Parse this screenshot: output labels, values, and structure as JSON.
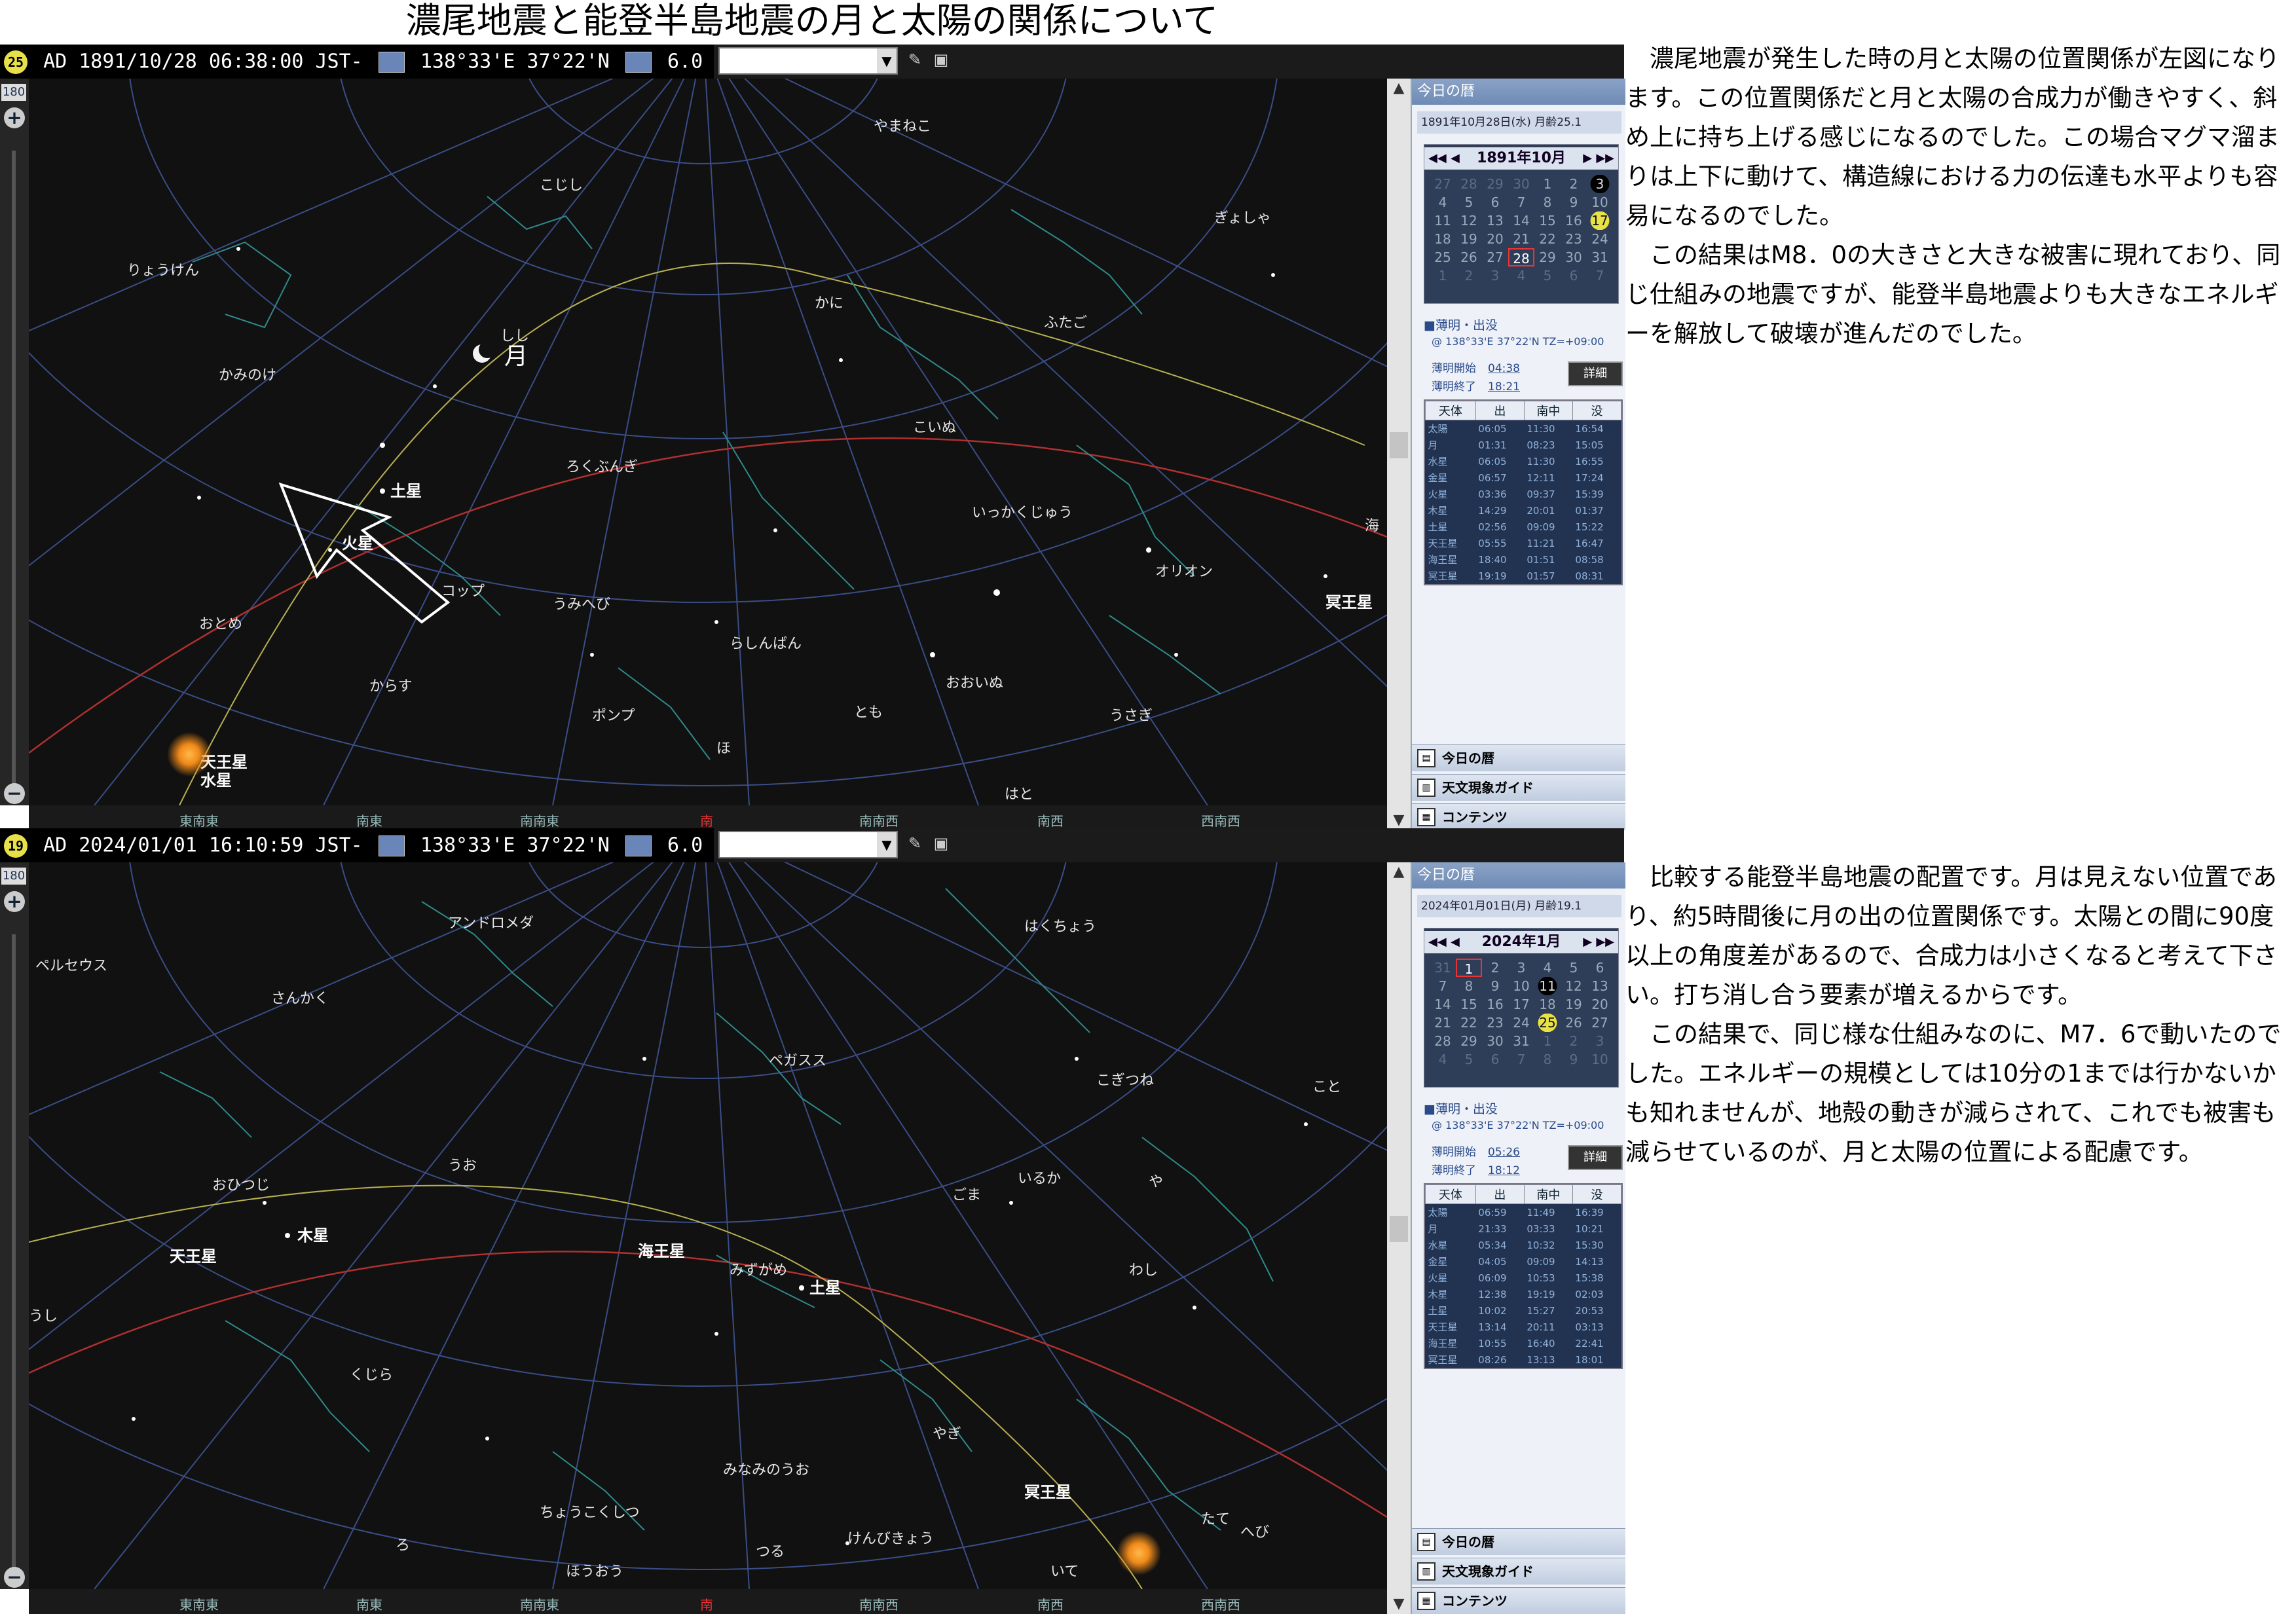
{
  "title": "濃尾地震と能登半島地震の月と太陽の関係について",
  "panels": [
    {
      "status": {
        "badge": "25",
        "datetime": "AD 1891/10/28 06:38:00 JST‐",
        "coords": "138°33'E 37°22'N",
        "mag": "6.0"
      },
      "scale_label": "180",
      "constellations": [
        "やまねこ",
        "こじし",
        "ぎょしゃ",
        "りょうけん",
        "かに",
        "ふたご",
        "しし",
        "かみのけ",
        "こいぬ",
        "ろくぶんぎ",
        "いっかくじゅう",
        "オリオン",
        "コップ",
        "うみへび",
        "おとめ",
        "らしんばん",
        "からす",
        "おおいぬ",
        "とも",
        "ポンプ",
        "うさぎ",
        "ほ",
        "はと",
        "海"
      ],
      "planets": [
        "土星",
        "火星",
        "冥王星",
        "天王星",
        "水星"
      ],
      "moon_label": "月",
      "directions": [
        "東南東",
        "南東",
        "南南東",
        "南",
        "南南西",
        "南西",
        "西南西"
      ],
      "side": {
        "header": "今日の暦",
        "date_line": "1891年10月28日(水)  月齢25.1",
        "month": "1891年10月",
        "nav_left": "◀◀ ◀",
        "nav_right": "▶ ▶▶",
        "weeks": [
          [
            "27",
            "28",
            "29",
            "30",
            "1",
            "2",
            "3"
          ],
          [
            "4",
            "5",
            "6",
            "7",
            "8",
            "9",
            "10"
          ],
          [
            "11",
            "12",
            "13",
            "14",
            "15",
            "16",
            "17"
          ],
          [
            "18",
            "19",
            "20",
            "21",
            "22",
            "23",
            "24"
          ],
          [
            "25",
            "26",
            "27",
            "28",
            "29",
            "30",
            "31"
          ],
          [
            "1",
            "2",
            "3",
            "4",
            "5",
            "6",
            "7"
          ]
        ],
        "twilight_head": "■薄明・出没",
        "twilight_loc": "@ 138°33'E 37°22'N TZ=+09:00",
        "twilight_start_label": "薄明開始",
        "twilight_start": "04:38",
        "twilight_end_label": "薄明終了",
        "twilight_end": "18:21",
        "detail": "詳細",
        "table_head": [
          "天体",
          "出",
          "南中",
          "没"
        ],
        "rows": [
          [
            "太陽",
            "06:05",
            "11:30",
            "16:54"
          ],
          [
            "月",
            "01:31",
            "08:23",
            "15:05"
          ],
          [
            "水星",
            "06:05",
            "11:30",
            "16:55"
          ],
          [
            "金星",
            "06:57",
            "12:11",
            "17:24"
          ],
          [
            "火星",
            "03:36",
            "09:37",
            "15:39"
          ],
          [
            "木星",
            "14:29",
            "20:01",
            "01:37"
          ],
          [
            "土星",
            "02:56",
            "09:09",
            "15:22"
          ],
          [
            "天王星",
            "05:55",
            "11:21",
            "16:47"
          ],
          [
            "海王星",
            "18:40",
            "01:51",
            "08:58"
          ],
          [
            "冥王星",
            "19:19",
            "01:57",
            "08:31"
          ]
        ],
        "buttons": [
          "今日の暦",
          "天文現象ガイド",
          "コンテンツ"
        ]
      },
      "description": [
        "濃尾地震が発生した時の月と太陽の位置関係が左図になります。この位置関係だと月と太陽の合成力が働きやすく、斜め上に持ち上げる感じになるのでした。この場合マグマ溜まりは上下に動けて、構造線における力の伝達も水平よりも容易になるのでした。",
        "この結果はM8．0の大きさと大きな被害に現れており、同じ仕組みの地震ですが、能登半島地震よりも大きなエネルギーを解放して破壊が進んだのでした。"
      ]
    },
    {
      "status": {
        "badge": "19",
        "datetime": "AD 2024/01/01 16:10:59 JST‐",
        "coords": "138°33'E 37°22'N",
        "mag": "6.0"
      },
      "scale_label": "180",
      "constellations": [
        "アンドロメダ",
        "はくちょう",
        "ペルセウス",
        "さんかく",
        "ペガスス",
        "こぎつね",
        "こと",
        "うお",
        "おひつじ",
        "ごま",
        "いるか",
        "や",
        "みずがめ",
        "わし",
        "くじら",
        "やぎ",
        "みなみのうお",
        "ちょうこくしつ",
        "つる",
        "けんびきょう",
        "たて",
        "へび",
        "ろ",
        "ほうおう",
        "いて",
        "うし"
      ],
      "planets": [
        "木星",
        "天王星",
        "海王星",
        "土星",
        "冥王星"
      ],
      "moon_label": "",
      "directions": [
        "東南東",
        "南東",
        "南南東",
        "南",
        "南南西",
        "南西",
        "西南西"
      ],
      "side": {
        "header": "今日の暦",
        "date_line": "2024年01月01日(月)  月齢19.1",
        "month": "2024年1月",
        "nav_left": "◀◀ ◀",
        "nav_right": "▶ ▶▶",
        "weeks": [
          [
            "31",
            "1",
            "2",
            "3",
            "4",
            "5",
            "6"
          ],
          [
            "7",
            "8",
            "9",
            "10",
            "11",
            "12",
            "13"
          ],
          [
            "14",
            "15",
            "16",
            "17",
            "18",
            "19",
            "20"
          ],
          [
            "21",
            "22",
            "23",
            "24",
            "25",
            "26",
            "27"
          ],
          [
            "28",
            "29",
            "30",
            "31",
            "1",
            "2",
            "3"
          ],
          [
            "4",
            "5",
            "6",
            "7",
            "8",
            "9",
            "10"
          ]
        ],
        "twilight_head": "■薄明・出没",
        "twilight_loc": "@ 138°33'E 37°22'N TZ=+09:00",
        "twilight_start_label": "薄明開始",
        "twilight_start": "05:26",
        "twilight_end_label": "薄明終了",
        "twilight_end": "18:12",
        "detail": "詳細",
        "table_head": [
          "天体",
          "出",
          "南中",
          "没"
        ],
        "rows": [
          [
            "太陽",
            "06:59",
            "11:49",
            "16:39"
          ],
          [
            "月",
            "21:33",
            "03:33",
            "10:21"
          ],
          [
            "水星",
            "05:34",
            "10:32",
            "15:30"
          ],
          [
            "金星",
            "04:05",
            "09:09",
            "14:13"
          ],
          [
            "火星",
            "06:09",
            "10:53",
            "15:38"
          ],
          [
            "木星",
            "12:38",
            "19:19",
            "02:03"
          ],
          [
            "土星",
            "10:02",
            "15:27",
            "20:53"
          ],
          [
            "天王星",
            "13:14",
            "20:11",
            "03:13"
          ],
          [
            "海王星",
            "10:55",
            "16:40",
            "22:41"
          ],
          [
            "冥王星",
            "08:26",
            "13:13",
            "18:01"
          ]
        ],
        "buttons": [
          "今日の暦",
          "天文現象ガイド",
          "コンテンツ"
        ]
      },
      "description": [
        "比較する能登半島地震の配置です。月は見えない位置であり、約5時間後に月の出の位置関係です。太陽との間に90度以上の角度差があるので、合成力は小さくなると考えて下さい。打ち消し合う要素が増えるからです。",
        "この結果で、同じ様な仕組みなのに、M7．6で動いたのでした。エネルギーの規模としては10分の1までは行かないかも知れませんが、地殻の動きが減らされて、これでも被害も減らせているのが、月と太陽の位置による配慮です。"
      ]
    }
  ]
}
